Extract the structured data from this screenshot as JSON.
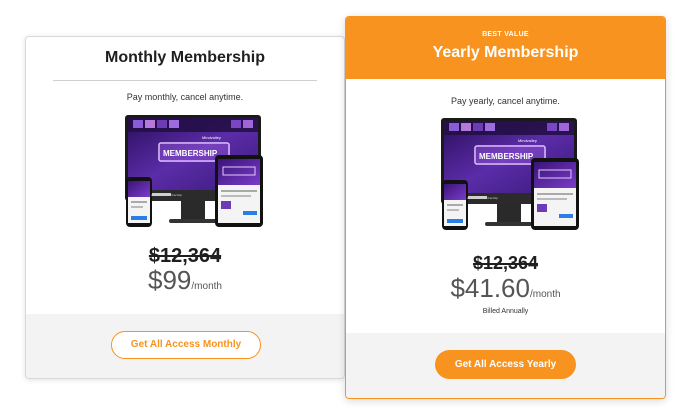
{
  "monthly": {
    "title": "Monthly Membership",
    "subtitle": "Pay monthly, cancel anytime.",
    "old_price": "$12,364",
    "price": "$99",
    "per": "/month",
    "button_label": "Get All Access Monthly",
    "device_image_alt": "Mindvalley Membership devices"
  },
  "yearly": {
    "badge": "BEST VALUE",
    "title": "Yearly Membership",
    "subtitle": "Pay yearly, cancel anytime.",
    "old_price": "$12,364",
    "price": "$41.60",
    "per": "/month",
    "billed": "Billed Annually",
    "button_label": "Get All Access Yearly",
    "device_image_alt": "Mindvalley Membership devices"
  },
  "device_screen": {
    "brand": "Mindvalley",
    "headline": "MEMBERSHIP",
    "caption": "All Access Membership"
  },
  "colors": {
    "accent": "#f7931e",
    "screen_bg": "#5b2ca8",
    "screen_glow": "#c77dff"
  }
}
